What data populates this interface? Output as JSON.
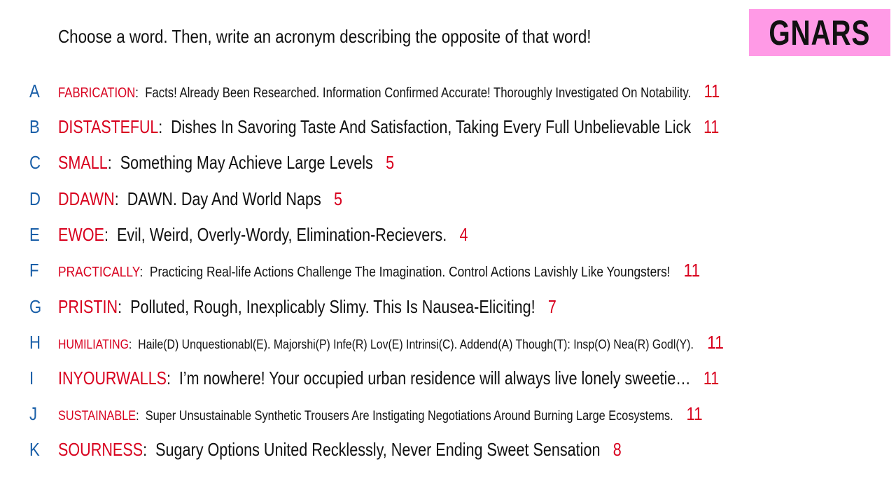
{
  "prompt": "Choose a word. Then, write an acronym describing the opposite of that word!",
  "logo_text": "GNARS",
  "colors": {
    "logo_background": "#ff9ae6",
    "word_color": "#d8001e",
    "letter_color": "#1a5fa8",
    "score_color": "#d8001e"
  },
  "entries": [
    {
      "letter": "A",
      "word": "FABRICATION",
      "sep": ":",
      "definition": "Facts! Already Been Researched. Information Confirmed Accurate! Thoroughly Investigated On Notability.",
      "score": "11"
    },
    {
      "letter": "B",
      "word": "DISTASTEFUL",
      "sep": ":",
      "definition": "Dishes In Savoring Taste And Satisfaction, Taking Every Full Unbelievable Lick",
      "score": "11"
    },
    {
      "letter": "C",
      "word": "SMALL",
      "sep": ":",
      "definition": "Something May Achieve Large Levels",
      "score": "5"
    },
    {
      "letter": "D",
      "word": "DDAWN",
      "sep": ":",
      "definition": "DAWN. Day And World Naps",
      "score": "5"
    },
    {
      "letter": "E",
      "word": "EWOE",
      "sep": ":",
      "definition": "Evil, Weird, Overly-Wordy, Elimination-Recievers.",
      "score": "4"
    },
    {
      "letter": "F",
      "word": "PRACTICALLY",
      "sep": ":",
      "definition": "Practicing Real-life Actions Challenge The Imagination. Control Actions Lavishly Like Youngsters!",
      "score": "11"
    },
    {
      "letter": "G",
      "word": "PRISTIN",
      "sep": ":",
      "definition": "Polluted, Rough, Inexplicably Slimy. This Is Nausea-Eliciting!",
      "score": "7"
    },
    {
      "letter": "H",
      "word": "HUMILIATING",
      "sep": ":",
      "definition": "Haile(D) Unquestionabl(E). Majorshi(P) Infe(R) Lov(E) Intrinsi(C). Addend(A) Though(T): Insp(O) Nea(R) Godl(Y).",
      "score": "11"
    },
    {
      "letter": "I",
      "word": "INYOURWALLS",
      "sep": ":",
      "definition": "I’m nowhere! Your occupied urban residence will always live lonely sweetie…",
      "score": "11"
    },
    {
      "letter": "J",
      "word": "SUSTAINABLE",
      "sep": ":",
      "definition": "Super Unsustainable Synthetic Trousers Are Instigating Negotiations Around Burning Large Ecosystems.",
      "score": "11"
    },
    {
      "letter": "K",
      "word": "SOURNESS",
      "sep": ":",
      "definition": "Sugary Options United Recklessly, Never Ending Sweet Sensation",
      "score": "8"
    }
  ]
}
